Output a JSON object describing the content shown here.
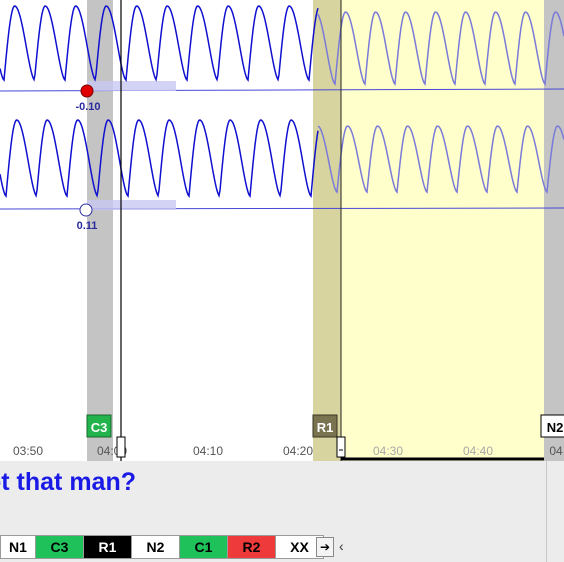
{
  "timeline": {
    "time_labels": [
      "03:50",
      "04:00",
      "04:10",
      "04:20",
      "04:30",
      "04:40",
      "04"
    ],
    "colors": {
      "trace": "#1010d0",
      "trace_faded": "#7a7ad8",
      "scored_band": "#c4c4c4",
      "selection": "#ffffcc"
    }
  },
  "channels": [
    {
      "marker_value": "-0.10",
      "marker_color": "#e00000"
    },
    {
      "marker_value": "0.11",
      "marker_color": "#ffffff"
    }
  ],
  "epoch_markers": [
    {
      "label": "C3",
      "bg": "#22b34c",
      "fg": "#ffffff"
    },
    {
      "label": "R1",
      "bg": "#7a7350",
      "fg": "#ffffff"
    },
    {
      "label": "N2",
      "bg": "#ffffff",
      "fg": "#000000"
    }
  ],
  "question": {
    "text": "ot that man?"
  },
  "stage_buttons": [
    {
      "label": "N1",
      "bg": "#ffffff",
      "fg": "#000000"
    },
    {
      "label": "C3",
      "bg": "#1fc25a",
      "fg": "#000000"
    },
    {
      "label": "R1",
      "bg": "#000000",
      "fg": "#ffffff"
    },
    {
      "label": "N2",
      "bg": "#ffffff",
      "fg": "#000000"
    },
    {
      "label": "C1",
      "bg": "#1fc25a",
      "fg": "#000000"
    },
    {
      "label": "R2",
      "bg": "#ee3a3a",
      "fg": "#000000"
    },
    {
      "label": "XX",
      "bg": "#ffffff",
      "fg": "#000000"
    }
  ],
  "controls": {
    "next_arrow_icon": "right-arrow-icon",
    "next_arrow_glyph": "➔",
    "chevron_icon": "chevron-left-icon",
    "chevron_glyph": "‹"
  }
}
